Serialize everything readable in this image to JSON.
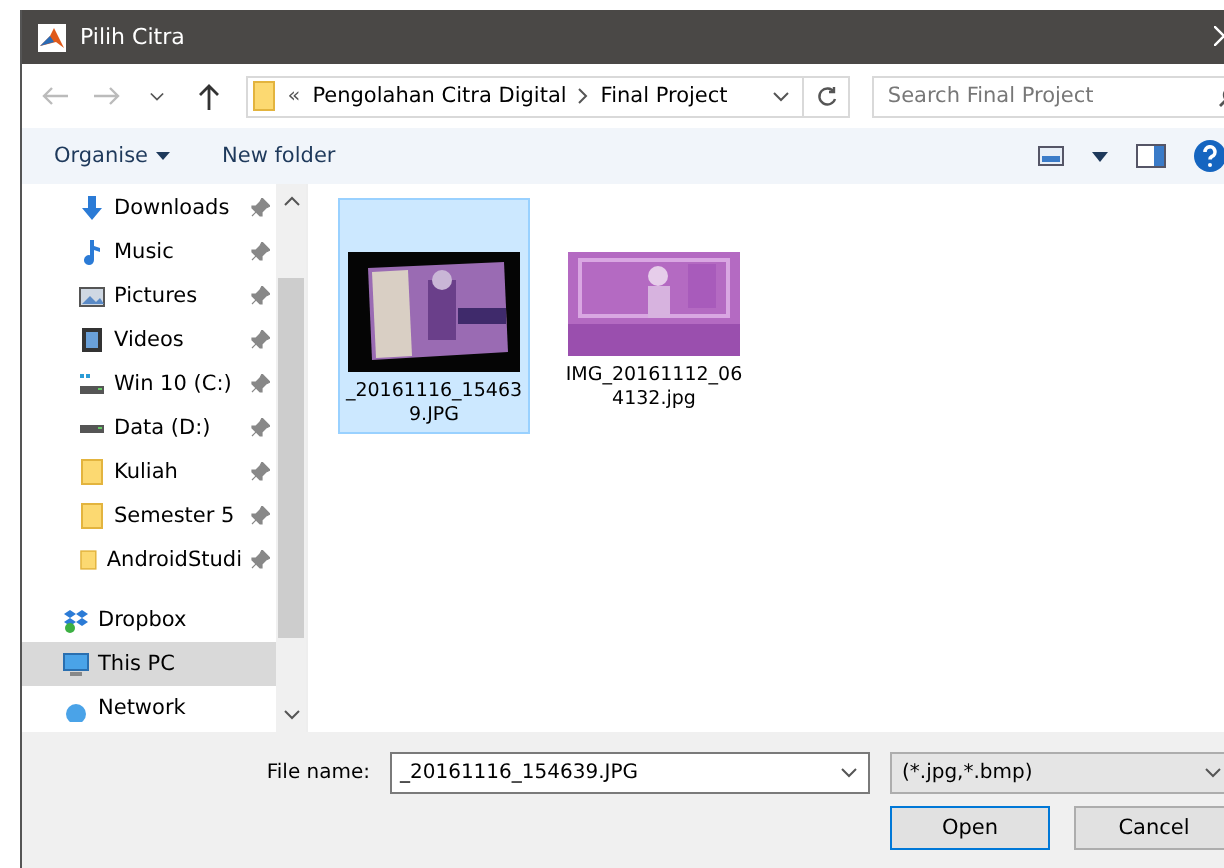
{
  "window": {
    "title": "Pilih Citra"
  },
  "address": {
    "overflow": "«",
    "crumbs": [
      "Pengolahan Citra Digital",
      "Final Project"
    ]
  },
  "search": {
    "placeholder": "Search Final Project"
  },
  "toolbar": {
    "organise": "Organise",
    "new_folder": "New folder"
  },
  "sidebar": {
    "items": [
      {
        "label": "Downloads",
        "kind": "downloads",
        "pinned": true,
        "selected": false
      },
      {
        "label": "Music",
        "kind": "music",
        "pinned": true,
        "selected": false
      },
      {
        "label": "Pictures",
        "kind": "pictures",
        "pinned": true,
        "selected": false
      },
      {
        "label": "Videos",
        "kind": "videos",
        "pinned": true,
        "selected": false
      },
      {
        "label": "Win 10 (C:)",
        "kind": "windrive",
        "pinned": true,
        "selected": false
      },
      {
        "label": "Data (D:)",
        "kind": "drive",
        "pinned": true,
        "selected": false
      },
      {
        "label": "Kuliah",
        "kind": "folder",
        "pinned": true,
        "selected": false
      },
      {
        "label": "Semester 5",
        "kind": "folder",
        "pinned": true,
        "selected": false
      },
      {
        "label": "AndroidStudi",
        "kind": "folder",
        "pinned": true,
        "selected": false
      },
      {
        "label": "Dropbox",
        "kind": "dropbox",
        "pinned": false,
        "selected": false
      },
      {
        "label": "This PC",
        "kind": "pc",
        "pinned": false,
        "selected": true
      },
      {
        "label": "Network",
        "kind": "network",
        "pinned": false,
        "selected": false
      }
    ]
  },
  "files": [
    {
      "name": "_20161116_15463\n9.JPG",
      "kind": "framed",
      "selected": true
    },
    {
      "name": "IMG_20161112_06\n4132.jpg",
      "kind": "full",
      "selected": false
    }
  ],
  "footer": {
    "file_name_label": "File name:",
    "file_name": "_20161116_154639.JPG",
    "filter": "(*.jpg,*.bmp)",
    "open": "Open",
    "cancel": "Cancel"
  }
}
